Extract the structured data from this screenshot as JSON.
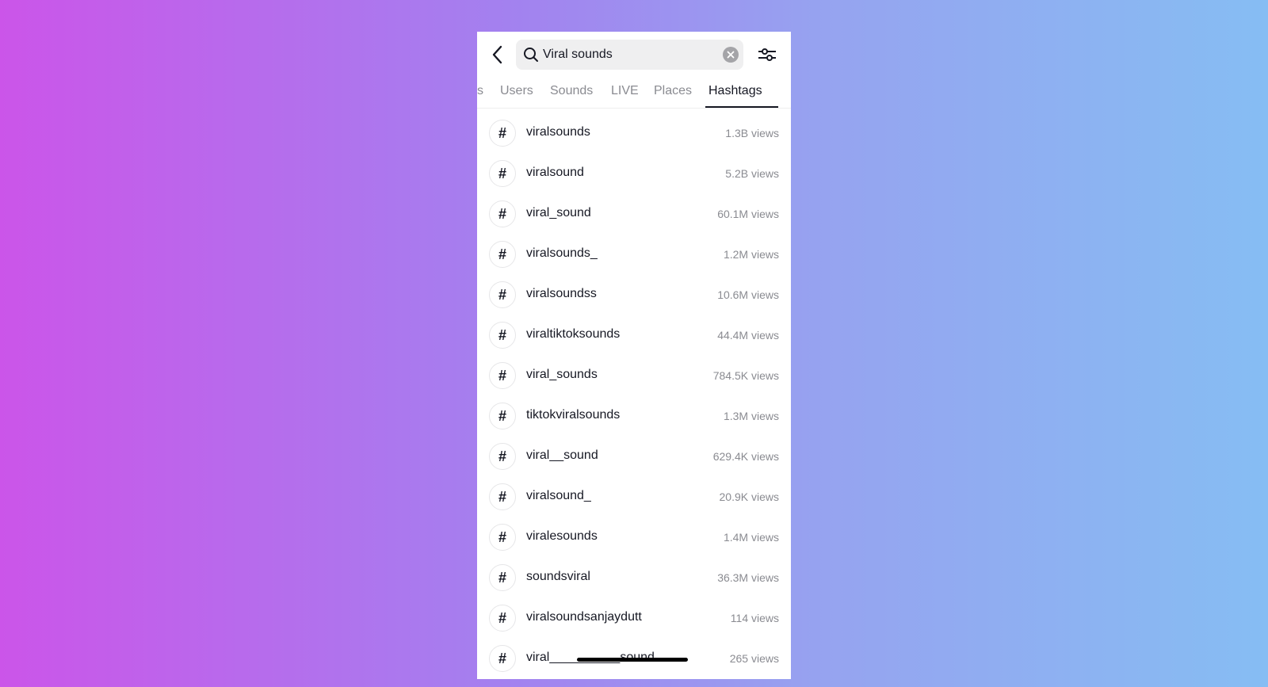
{
  "search": {
    "query": "Viral sounds"
  },
  "tabs": [
    {
      "label": "s"
    },
    {
      "label": "Users"
    },
    {
      "label": "Sounds"
    },
    {
      "label": "LIVE"
    },
    {
      "label": "Places"
    },
    {
      "label": "Hashtags",
      "active": true
    }
  ],
  "icons": {
    "back": "chevron-left",
    "search": "magnifier",
    "clear": "x-circle",
    "filter": "sliders",
    "hashtag": "#"
  },
  "hashtags": [
    {
      "name": "viralsounds",
      "views": "1.3B views"
    },
    {
      "name": "viralsound",
      "views": "5.2B views"
    },
    {
      "name": "viral_sound",
      "views": "60.1M views"
    },
    {
      "name": "viralsounds_",
      "views": "1.2M views"
    },
    {
      "name": "viralsoundss",
      "views": "10.6M views"
    },
    {
      "name": "viraltiktoksounds",
      "views": "44.4M views"
    },
    {
      "name": "viral_sounds",
      "views": "784.5K views"
    },
    {
      "name": "tiktokviralsounds",
      "views": "1.3M views"
    },
    {
      "name": "viral__sound",
      "views": "629.4K views"
    },
    {
      "name": "viralsound_",
      "views": "20.9K views"
    },
    {
      "name": "viralesounds",
      "views": "1.4M views"
    },
    {
      "name": "soundsviral",
      "views": "36.3M views"
    },
    {
      "name": "viralsoundsanjaydutt",
      "views": "114 views"
    },
    {
      "name": "viral__________sound",
      "views": "265 views"
    }
  ]
}
